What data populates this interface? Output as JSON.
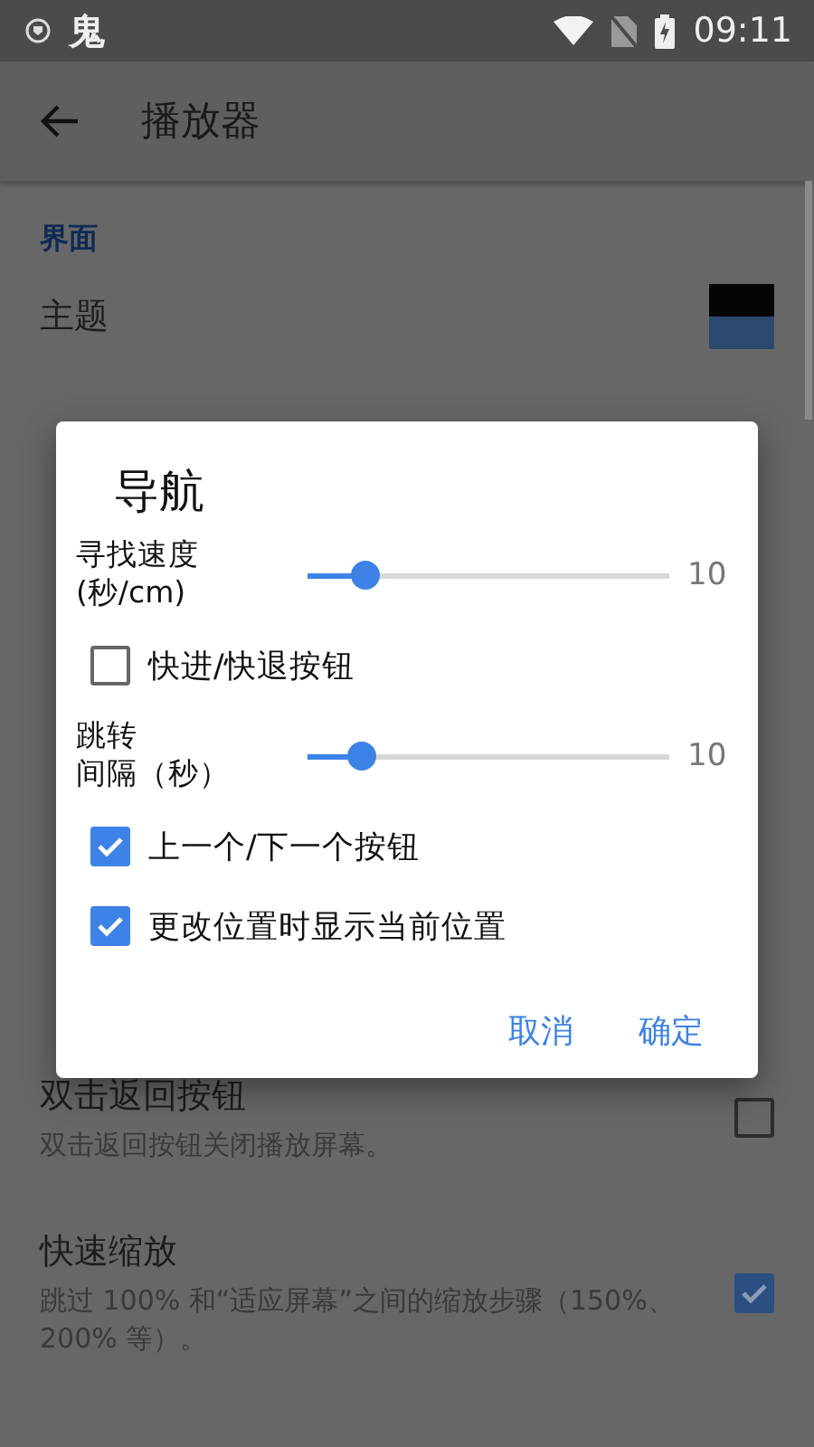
{
  "status_bar": {
    "time": "09:11",
    "app_glyph": "鬼"
  },
  "app_bar": {
    "title": "播放器"
  },
  "sections": [
    {
      "header": "界面",
      "items": [
        {
          "kind": "theme",
          "title": "主题"
        }
      ]
    }
  ],
  "settings": [
    {
      "kind": "checkbox",
      "title": "双击返回按钮",
      "summary": "双击返回按钮关闭播放屏幕。",
      "checked": false
    },
    {
      "kind": "checkbox",
      "title": "快速缩放",
      "summary": "跳过 100% 和“适应屏幕”之间的缩放步骤（150%、200% 等）。",
      "checked": true
    }
  ],
  "dialog": {
    "title": "导航",
    "rows": [
      {
        "kind": "slider",
        "label_lines": [
          "寻找速度",
          "(秒/cm)"
        ],
        "level": 0.16,
        "reading": "10"
      },
      {
        "kind": "checkbox",
        "label": "快进/快退按钮",
        "checked": false
      },
      {
        "kind": "slider",
        "label_lines": [
          "跳转",
          "间隔（秒）"
        ],
        "level": 0.15,
        "reading": "10"
      },
      {
        "kind": "checkbox",
        "label": "上一个/下一个按钮",
        "checked": true
      },
      {
        "kind": "checkbox",
        "label": "更改位置时显示当前位置",
        "checked": true
      }
    ],
    "buttons": [
      "取消",
      "确定"
    ]
  }
}
